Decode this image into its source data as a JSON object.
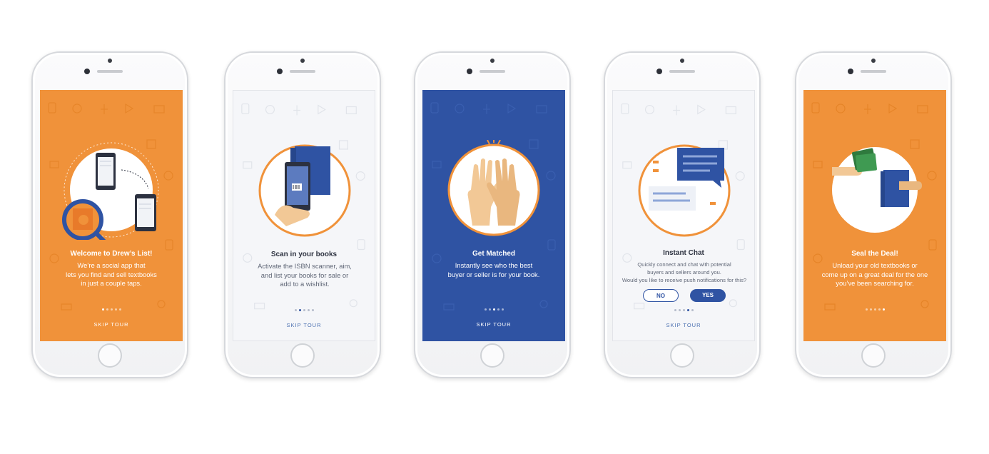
{
  "colors": {
    "orange": "#f0923a",
    "blue": "#2f53a3",
    "light": "#f5f6f9"
  },
  "screens": [
    {
      "title": "Welcome to Drew’s List!",
      "body": [
        "We’re a social app that",
        "lets you find and sell textbooks",
        "in just a couple taps."
      ],
      "skip": "SKIP TOUR",
      "active_dot": 1,
      "icon": "phones-search-illustration"
    },
    {
      "title": "Scan in your books",
      "body": [
        "Activate the ISBN scanner, aim,",
        "and list your books for sale or",
        "add to a wishlist."
      ],
      "skip": "SKIP TOUR",
      "active_dot": 2,
      "icon": "scan-book-illustration"
    },
    {
      "title": "Get Matched",
      "body": [
        "Instantly see who the best",
        "buyer or seller is for your book."
      ],
      "skip": "SKIP TOUR",
      "active_dot": 3,
      "icon": "high-five-illustration"
    },
    {
      "title": "Instant Chat",
      "body": [
        "Quickly connect and chat with potential",
        "buyers and sellers around you.",
        "Would you like to receive push notifications for this?"
      ],
      "no": "NO",
      "yes": "YES",
      "skip": "SKIP TOUR",
      "active_dot": 4,
      "icon": "chat-bubbles-illustration"
    },
    {
      "title": "Seal the Deal!",
      "body": [
        "Unload your old textbooks or",
        "come up on a great deal for the one",
        "you’ve been searching for."
      ],
      "active_dot": 5,
      "icon": "money-book-exchange-illustration"
    }
  ]
}
